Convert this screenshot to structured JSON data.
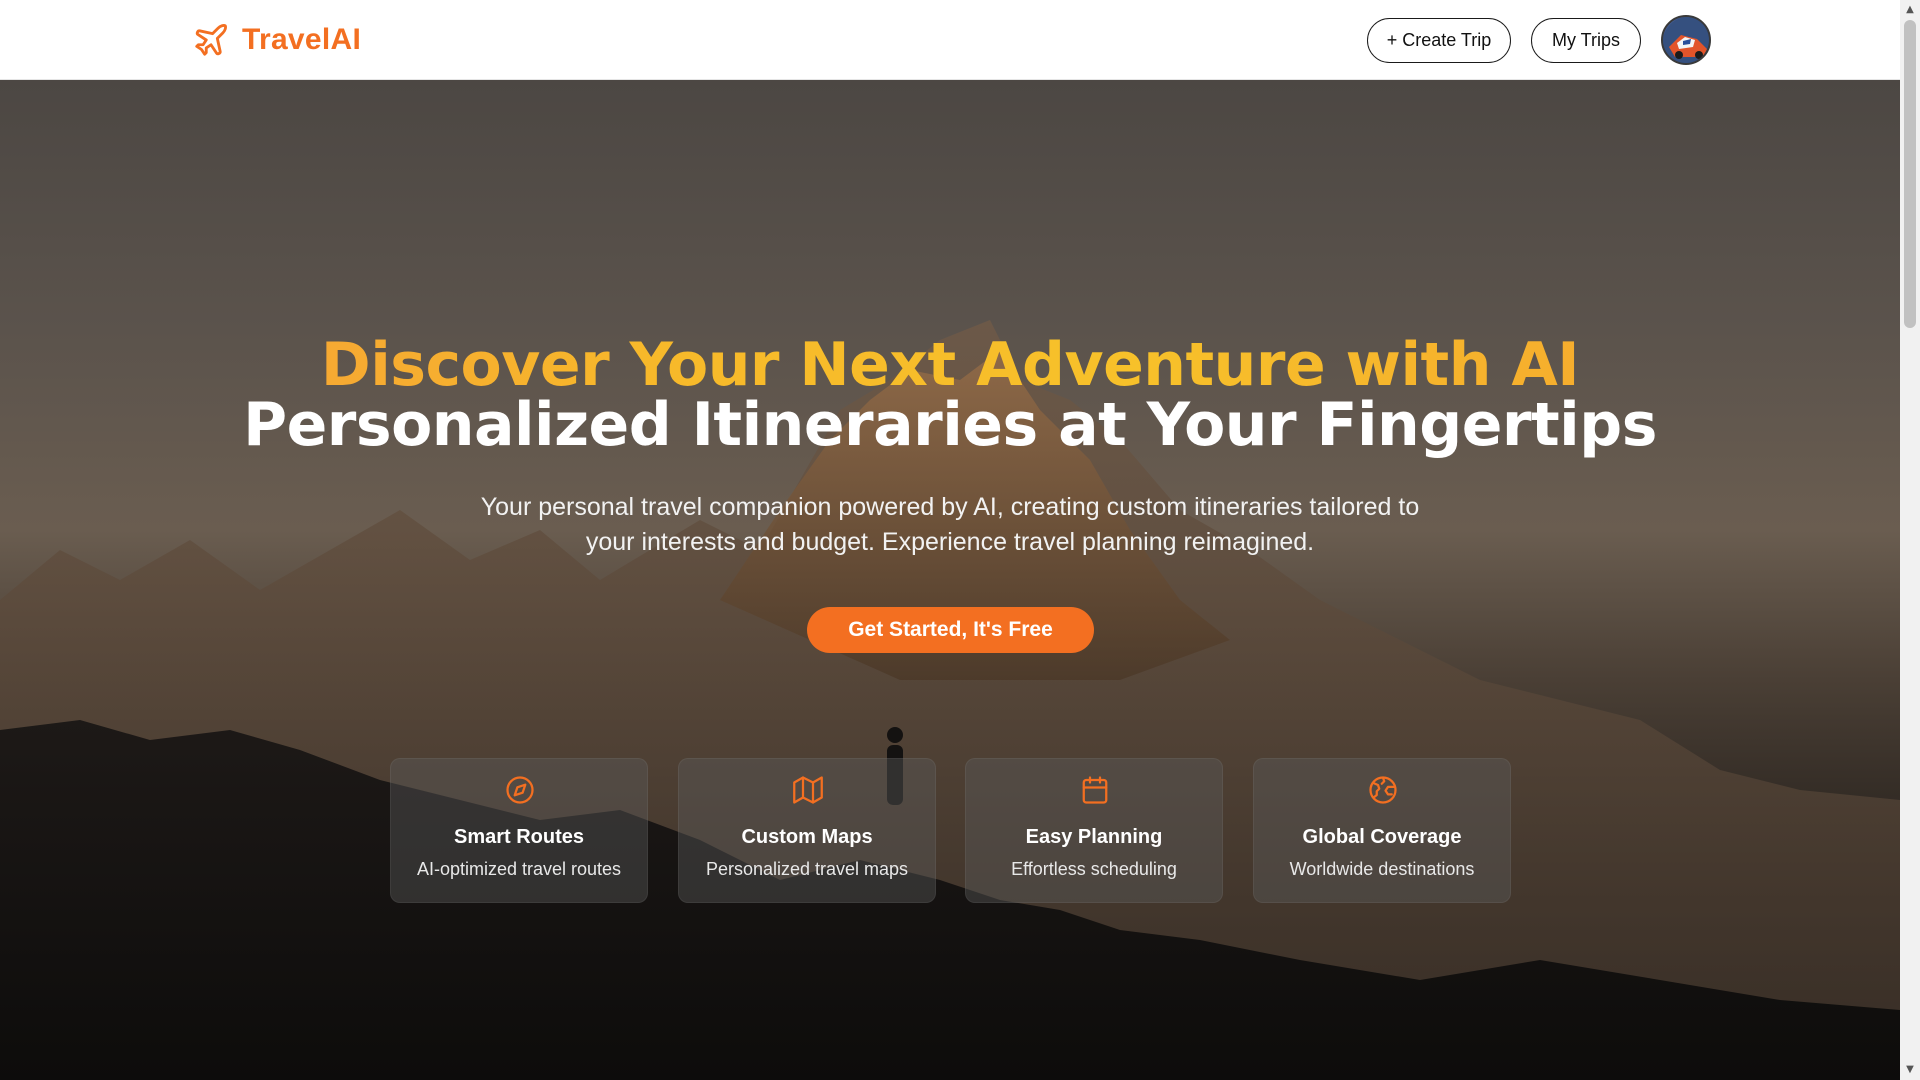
{
  "nav": {
    "brand": "TravelAI",
    "brand_icon": "airplane-icon",
    "create_trip": "+ Create Trip",
    "my_trips": "My Trips",
    "avatar_icon": "user-avatar"
  },
  "hero": {
    "title_line1": "Discover Your Next Adventure with AI",
    "title_line2": "Personalized Itineraries at Your Fingertips",
    "subtitle": "Your personal travel companion powered by AI, creating custom itineraries tailored to your interests and budget. Experience travel planning reimagined.",
    "cta": "Get Started, It's Free"
  },
  "features": [
    {
      "icon": "compass-icon",
      "title": "Smart Routes",
      "description": "AI-optimized travel routes"
    },
    {
      "icon": "map-icon",
      "title": "Custom Maps",
      "description": "Personalized travel maps"
    },
    {
      "icon": "calendar-icon",
      "title": "Easy Planning",
      "description": "Effortless scheduling"
    },
    {
      "icon": "globe-icon",
      "title": "Global Coverage",
      "description": "Worldwide destinations"
    }
  ],
  "colors": {
    "brand": "#f36f21",
    "title_gradient_start": "#f59a3a",
    "title_gradient_end": "#f7c12a",
    "nav_background": "#ffffff"
  }
}
